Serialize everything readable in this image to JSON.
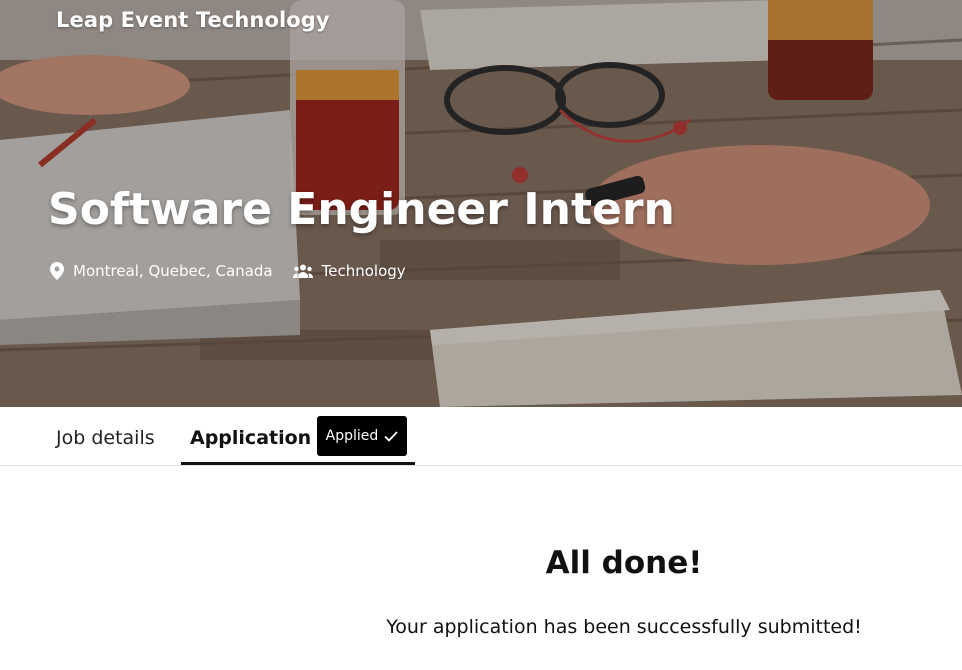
{
  "header": {
    "company": "Leap Event Technology",
    "job_title": "Software Engineer Intern",
    "location": "Montreal, Quebec, Canada",
    "department": "Technology"
  },
  "tabs": {
    "job_details": "Job details",
    "application": "Application",
    "applied_badge": "Applied"
  },
  "confirmation": {
    "heading": "All done!",
    "message": "Your application has been successfully submitted!"
  },
  "icons": {
    "location": "map-pin-icon",
    "department": "people-icon",
    "applied": "check-icon"
  },
  "colors": {
    "badge_bg": "#000000",
    "text": "#111111",
    "hero_text": "#ffffff"
  }
}
